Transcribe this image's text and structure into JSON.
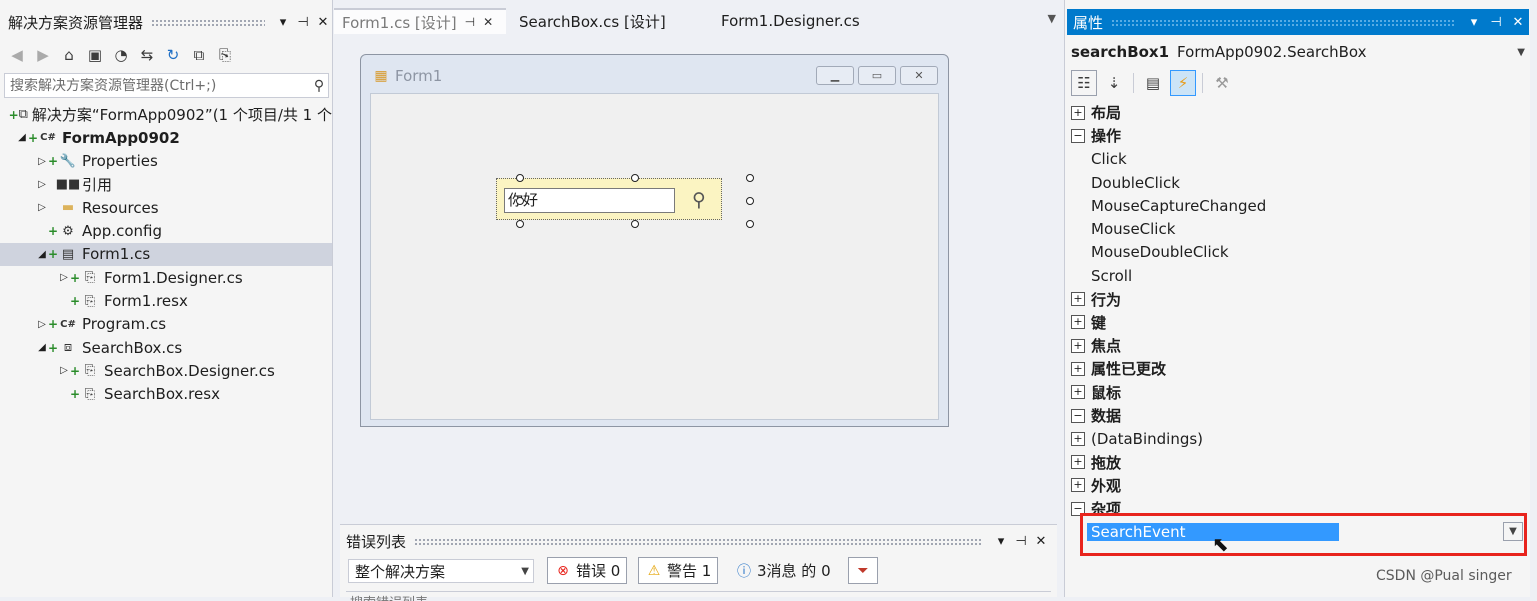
{
  "solution_explorer": {
    "title": "解决方案资源管理器",
    "title_buttons": [
      "▾",
      "⊣",
      "✕"
    ],
    "search_placeholder": "搜索解决方案资源管理器(Ctrl+;)",
    "tree": [
      {
        "label": "解决方案“FormApp0902”(1 个项目/共 1 个",
        "icon": "solution-icon",
        "depth": 0,
        "expander": "",
        "plus": "+",
        "bold": false
      },
      {
        "label": "FormApp0902",
        "icon": "csharp-project-icon",
        "depth": 1,
        "expander": "◢",
        "plus": "+",
        "bold": true
      },
      {
        "label": "Properties",
        "icon": "wrench-icon",
        "depth": 2,
        "expander": "▷",
        "plus": "+",
        "bold": false
      },
      {
        "label": "引用",
        "icon": "references-icon",
        "depth": 2,
        "expander": "▷",
        "plus": "",
        "bold": false
      },
      {
        "label": "Resources",
        "icon": "folder-icon",
        "depth": 2,
        "expander": "▷",
        "plus": "",
        "bold": false
      },
      {
        "label": "App.config",
        "icon": "config-file-icon",
        "depth": 2,
        "expander": "",
        "plus": "+",
        "bold": false
      },
      {
        "label": "Form1.cs",
        "icon": "form-icon",
        "depth": 2,
        "expander": "◢",
        "plus": "+",
        "bold": false,
        "selected": true
      },
      {
        "label": "Form1.Designer.cs",
        "icon": "cs-file-icon",
        "depth": 3,
        "expander": "▷",
        "plus": "+",
        "bold": false
      },
      {
        "label": "Form1.resx",
        "icon": "resx-file-icon",
        "depth": 3,
        "expander": "",
        "plus": "+",
        "bold": false
      },
      {
        "label": "Program.cs",
        "icon": "csharp-file-icon",
        "depth": 2,
        "expander": "▷",
        "plus": "+",
        "bold": false
      },
      {
        "label": "SearchBox.cs",
        "icon": "usercontrol-icon",
        "depth": 2,
        "expander": "◢",
        "plus": "+",
        "bold": false
      },
      {
        "label": "SearchBox.Designer.cs",
        "icon": "cs-file-icon",
        "depth": 3,
        "expander": "▷",
        "plus": "+",
        "bold": false
      },
      {
        "label": "SearchBox.resx",
        "icon": "resx-file-icon",
        "depth": 3,
        "expander": "",
        "plus": "+",
        "bold": false
      }
    ]
  },
  "doc_tabs": [
    {
      "label": "Form1.cs [设计]",
      "active": true,
      "pin": "⊣",
      "close": "✕"
    },
    {
      "label": "SearchBox.cs [设计]",
      "active": false
    },
    {
      "label": "Form1.Designer.cs",
      "active": false
    }
  ],
  "designer": {
    "form_title": "Form1",
    "searchbox_text": "你好"
  },
  "error_list": {
    "title": "错误列表",
    "scope": "整个解决方案",
    "errors_label": "错误 0",
    "warnings_label": "警告 1",
    "messages_label": "3消息 的 0",
    "search_placeholder": "搜索错误列表"
  },
  "properties": {
    "title": "属性",
    "object_name": "searchBox1",
    "object_type": "FormApp0902.SearchBox",
    "rows": [
      {
        "type": "cat",
        "label": "布局",
        "expanded": false
      },
      {
        "type": "cat",
        "label": "操作",
        "expanded": true
      },
      {
        "type": "ev",
        "label": "Click"
      },
      {
        "type": "ev",
        "label": "DoubleClick"
      },
      {
        "type": "ev",
        "label": "MouseCaptureChanged"
      },
      {
        "type": "ev",
        "label": "MouseClick"
      },
      {
        "type": "ev",
        "label": "MouseDoubleClick"
      },
      {
        "type": "ev",
        "label": "Scroll"
      },
      {
        "type": "cat",
        "label": "行为",
        "expanded": false
      },
      {
        "type": "cat",
        "label": "键",
        "expanded": false
      },
      {
        "type": "cat",
        "label": "焦点",
        "expanded": false
      },
      {
        "type": "cat",
        "label": "属性已更改",
        "expanded": false
      },
      {
        "type": "cat",
        "label": "鼠标",
        "expanded": false
      },
      {
        "type": "cat",
        "label": "数据",
        "expanded": true
      },
      {
        "type": "cat",
        "label": "(DataBindings)",
        "expanded": false,
        "plain": true
      },
      {
        "type": "cat",
        "label": "拖放",
        "expanded": false
      },
      {
        "type": "cat",
        "label": "外观",
        "expanded": false
      },
      {
        "type": "cat",
        "label": "杂项",
        "expanded": true
      },
      {
        "type": "ev",
        "label": "SearchEvent",
        "selected": true
      }
    ]
  },
  "watermark": "CSDN @Pual singer",
  "colors": {
    "accent": "#007acc",
    "selection": "#3399ff",
    "highlight_box": "#e8241d"
  }
}
